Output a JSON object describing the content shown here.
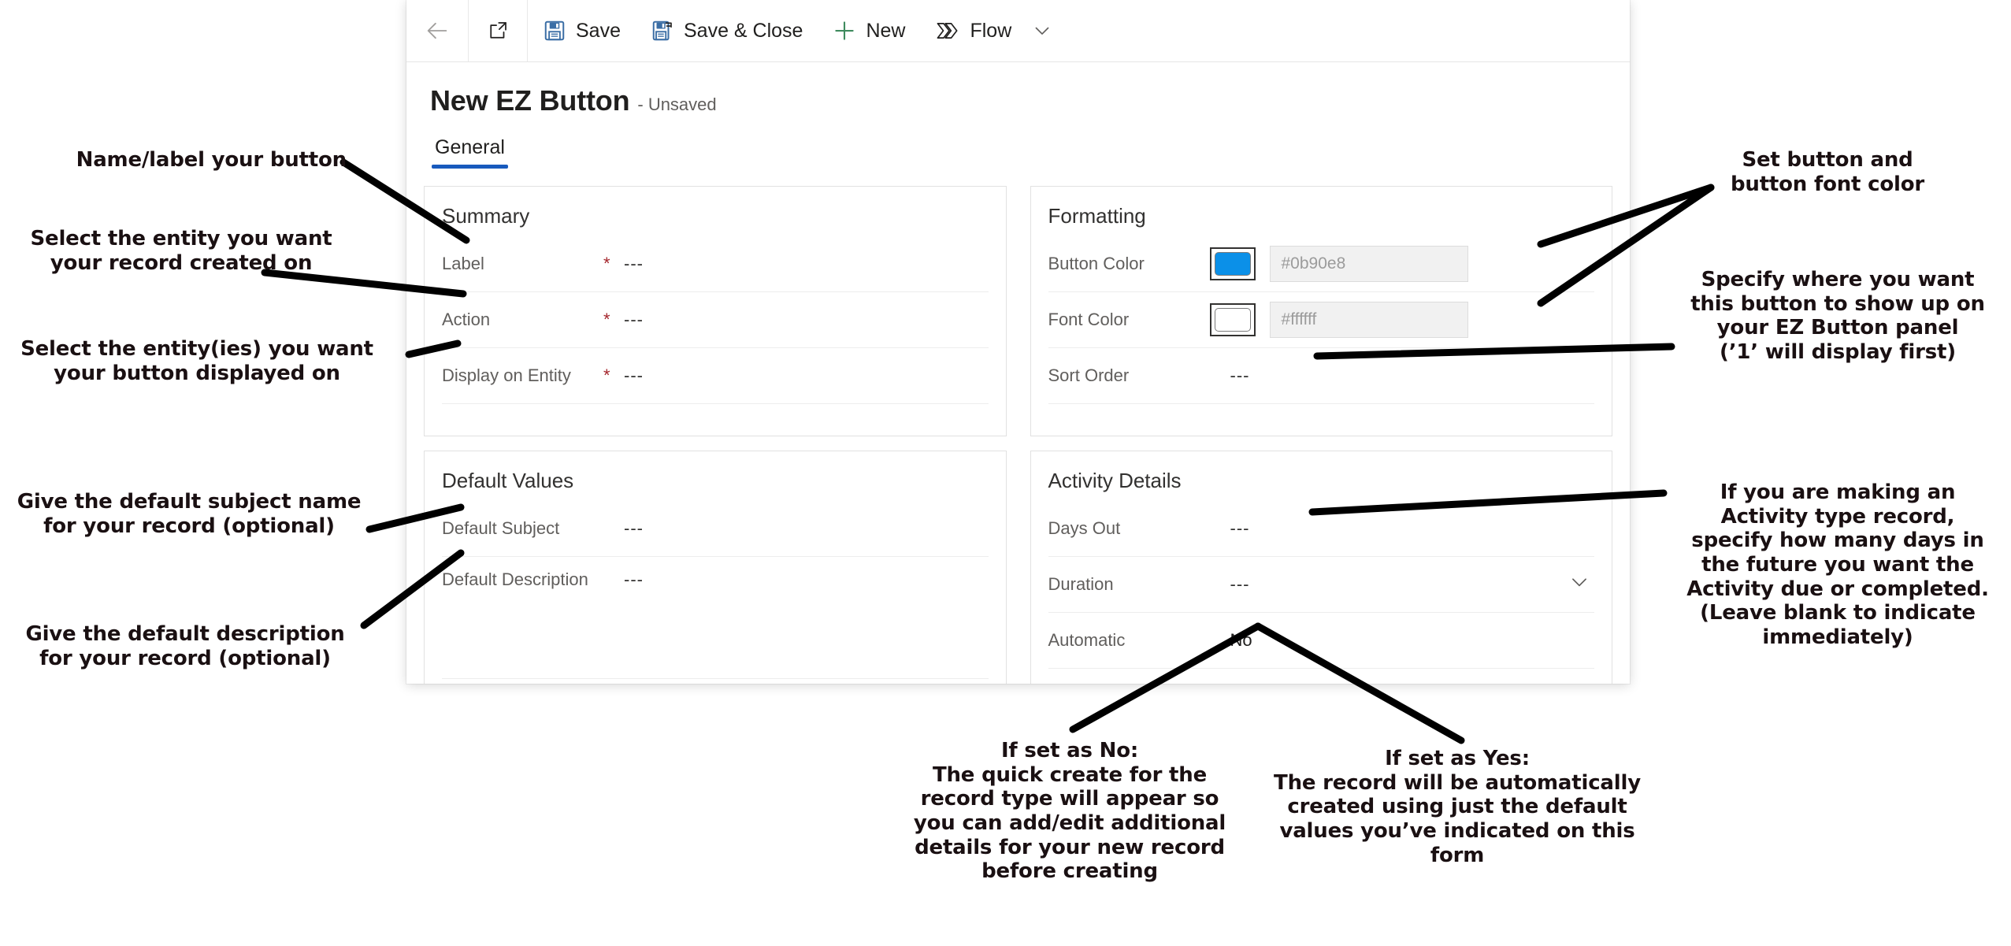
{
  "window": {
    "commandbar": {
      "back_icon": "back-arrow-icon",
      "popout_icon": "open-in-new-window-icon",
      "items": [
        {
          "id": "save",
          "label": "Save",
          "icon": "save-floppy-icon"
        },
        {
          "id": "save-close",
          "label": "Save & Close",
          "icon": "save-and-close-icon"
        },
        {
          "id": "new",
          "label": "New",
          "icon": "plus-icon"
        },
        {
          "id": "flow",
          "label": "Flow",
          "icon": "flow-icon"
        }
      ],
      "overflow_icon": "chevron-down-icon"
    },
    "header": {
      "title": "New EZ Button",
      "subtitle": "- Unsaved"
    },
    "tabs": [
      {
        "id": "general",
        "label": "General",
        "active": true
      }
    ],
    "cards": {
      "summary": {
        "title": "Summary",
        "fields": [
          {
            "label": "Label",
            "required": "*",
            "value": "---"
          },
          {
            "label": "Action",
            "required": "*",
            "value": "---"
          },
          {
            "label": "Display on Entity",
            "required": "*",
            "value": "---"
          }
        ]
      },
      "formatting": {
        "title": "Formatting",
        "button_color": {
          "label": "Button Color",
          "swatch_hex": "#0b90e8",
          "placeholder": "#0b90e8"
        },
        "font_color": {
          "label": "Font Color",
          "swatch_hex": "#ffffff",
          "placeholder": "#ffffff"
        },
        "sort_order": {
          "label": "Sort Order",
          "value": "---"
        }
      },
      "default_values": {
        "title": "Default Values",
        "fields": [
          {
            "label": "Default Subject",
            "value": "---"
          },
          {
            "label": "Default Description",
            "value": "---"
          }
        ]
      },
      "activity_details": {
        "title": "Activity Details",
        "fields": [
          {
            "label": "Days Out",
            "value": "---",
            "chevron": false
          },
          {
            "label": "Duration",
            "value": "---",
            "chevron": true
          },
          {
            "label": "Automatic",
            "value": "No",
            "chevron": false
          }
        ]
      }
    }
  },
  "annotations": [
    {
      "id": "a1",
      "text": "Name/label your button"
    },
    {
      "id": "a2",
      "text": "Select the entity you want\nyour record created on"
    },
    {
      "id": "a3",
      "text": "Select the entity(ies) you want\nyour button displayed on"
    },
    {
      "id": "a4",
      "text": "Give the default subject name\nfor your record (optional)"
    },
    {
      "id": "a5",
      "text": "Give the default description\nfor your record (optional)"
    },
    {
      "id": "a6",
      "text": "Set button and\nbutton font color"
    },
    {
      "id": "a7",
      "text": "Specify where you want\nthis button to show up on\nyour EZ Button panel\n(’1’ will display first)"
    },
    {
      "id": "a8",
      "text": "If you are making an\nActivity type record,\nspecify how many days in\nthe future you want the\nActivity due or completed.\n(Leave blank to indicate\nimmediately)"
    },
    {
      "id": "a9",
      "text": "If set as No:\nThe quick create for the\nrecord type will appear so\nyou can add/edit additional\ndetails for your new record\nbefore creating"
    },
    {
      "id": "a10",
      "text": "If set as Yes:\nThe record will be automatically\ncreated using just the default\nvalues you’ve indicated on this\nform"
    }
  ],
  "colors": {
    "accent_tab": "#185abd",
    "required_asterisk": "#a4262c",
    "button_color_swatch": "#0b90e8",
    "font_color_swatch": "#ffffff",
    "annotation_text": "#1a1012"
  }
}
